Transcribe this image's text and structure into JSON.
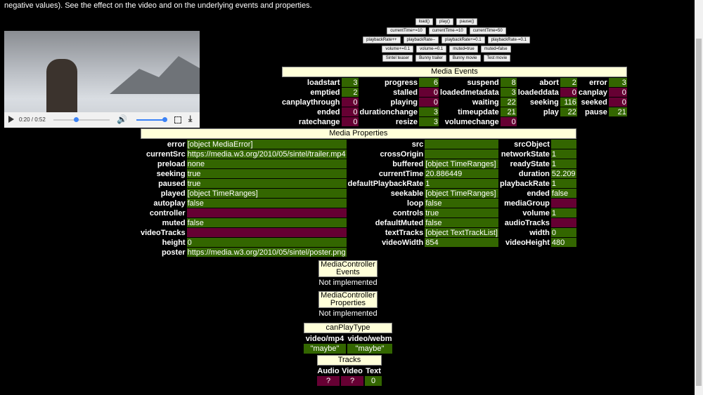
{
  "intro": "negative values). See the effect on the video and on the underlying events and properties.",
  "video": {
    "time": "0:20 / 0:52",
    "progress": 0.4,
    "volume": 1.0
  },
  "buttons": [
    [
      "load()",
      "play()",
      "pause()"
    ],
    [
      "currentTime+=10",
      "currentTime-=10",
      "currentTime=50"
    ],
    [
      "playbackRate++",
      "playbackRate--",
      "playbackRate+=0.1",
      "playbackRate-=0.1"
    ],
    [
      "volume+=0.1",
      "volume-=0.1",
      "muted=true",
      "muted=false"
    ],
    [
      "Sintel teaser",
      "Bunny trailer",
      "Bunny movie",
      "Test movie"
    ]
  ],
  "colors": {
    "ok": "#336600",
    "bad": "#660033",
    "header": "#ffffd9"
  },
  "events": {
    "title": "Media Events",
    "rows": [
      [
        [
          "loadstart",
          "3"
        ],
        [
          "progress",
          "6"
        ],
        [
          "suspend",
          "8"
        ],
        [
          "abort",
          "2"
        ],
        [
          "error",
          "3"
        ]
      ],
      [
        [
          "emptied",
          "2"
        ],
        [
          "stalled",
          "0"
        ],
        [
          "loadedmetadata",
          "3"
        ],
        [
          "loadeddata",
          "0"
        ],
        [
          "canplay",
          "0"
        ]
      ],
      [
        [
          "canplaythrough",
          "0"
        ],
        [
          "playing",
          "0"
        ],
        [
          "waiting",
          "22"
        ],
        [
          "seeking",
          "116"
        ],
        [
          "seeked",
          "0"
        ]
      ],
      [
        [
          "ended",
          "0"
        ],
        [
          "durationchange",
          "3"
        ],
        [
          "timeupdate",
          "21"
        ],
        [
          "play",
          "22"
        ],
        [
          "pause",
          "21"
        ]
      ],
      [
        [
          "ratechange",
          "0"
        ],
        [
          "resize",
          "3"
        ],
        [
          "volumechange",
          "0"
        ]
      ]
    ]
  },
  "properties": {
    "title": "Media Properties",
    "rows": [
      [
        [
          "error",
          "[object MediaError]",
          "g"
        ],
        [
          "src",
          "",
          "g"
        ],
        [
          "srcObject",
          "",
          "g"
        ]
      ],
      [
        [
          "currentSrc",
          "https://media.w3.org/2010/05/sintel/trailer.mp4",
          "g"
        ],
        [
          "crossOrigin",
          "",
          "g"
        ],
        [
          "networkState",
          "1",
          "g"
        ]
      ],
      [
        [
          "preload",
          "none",
          "g"
        ],
        [
          "buffered",
          "[object TimeRanges]",
          "g"
        ],
        [
          "readyState",
          "1",
          "g"
        ]
      ],
      [
        [
          "seeking",
          "true",
          "g"
        ],
        [
          "currentTime",
          "20.886449",
          "g"
        ],
        [
          "duration",
          "52.209",
          "g"
        ]
      ],
      [
        [
          "paused",
          "true",
          "g"
        ],
        [
          "defaultPlaybackRate",
          "1",
          "g"
        ],
        [
          "playbackRate",
          "1",
          "g"
        ]
      ],
      [
        [
          "played",
          "[object TimeRanges]",
          "g"
        ],
        [
          "seekable",
          "[object TimeRanges]",
          "g"
        ],
        [
          "ended",
          "false",
          "g"
        ]
      ],
      [
        [
          "autoplay",
          "false",
          "g"
        ],
        [
          "loop",
          "false",
          "g"
        ],
        [
          "mediaGroup",
          "",
          "m"
        ]
      ],
      [
        [
          "controller",
          "",
          "m"
        ],
        [
          "controls",
          "true",
          "g"
        ],
        [
          "volume",
          "1",
          "g"
        ]
      ],
      [
        [
          "muted",
          "false",
          "g"
        ],
        [
          "defaultMuted",
          "false",
          "g"
        ],
        [
          "audioTracks",
          "",
          "m"
        ]
      ],
      [
        [
          "videoTracks",
          "",
          "m"
        ],
        [
          "textTracks",
          "[object TextTrackList]",
          "g"
        ],
        [
          "width",
          "0",
          "g"
        ]
      ],
      [
        [
          "height",
          "0",
          "g"
        ],
        [
          "videoWidth",
          "854",
          "g"
        ],
        [
          "videoHeight",
          "480",
          "g"
        ]
      ],
      [
        [
          "poster",
          "https://media.w3.org/2010/05/sintel/poster.png",
          "g"
        ]
      ]
    ]
  },
  "mc_events": {
    "title_1": "MediaController",
    "title_2": "Events",
    "status": "Not implemented"
  },
  "mc_props": {
    "title_1": "MediaController",
    "title_2": "Properties",
    "status": "Not implemented"
  },
  "canplay": {
    "title": "canPlayType",
    "headers": [
      "video/mp4",
      "video/webm"
    ],
    "values": [
      "\"maybe\"",
      "\"maybe\""
    ]
  },
  "tracks": {
    "title": "Tracks",
    "headers": [
      "Audio",
      "Video",
      "Text"
    ],
    "values": [
      "?",
      "?",
      "0"
    ]
  }
}
